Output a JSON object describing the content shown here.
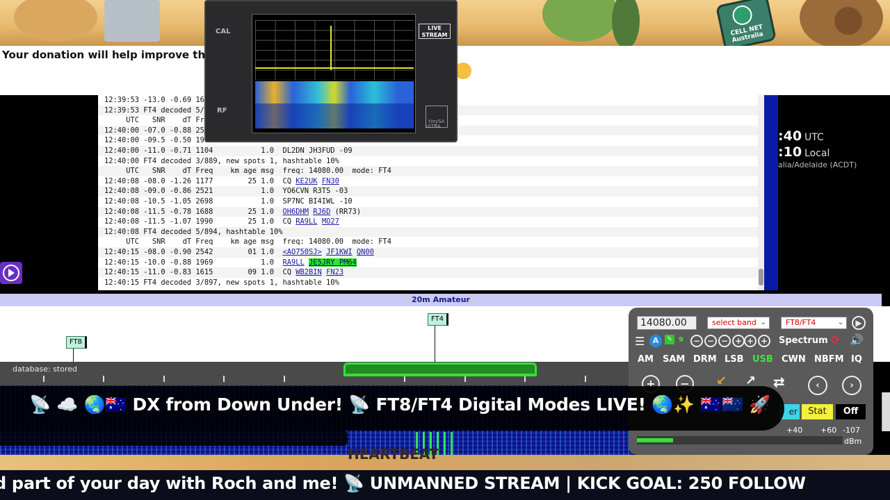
{
  "donation": {
    "text": "Your donation will help improve the"
  },
  "phone_ad": {
    "text": "CELL NET Australia"
  },
  "log": {
    "lines": [
      [
        {
          "t": "12:39:53 -13.0 -0.69 16"
        }
      ],
      [
        {
          "t": "12:39:53 FT4 decoded 5/"
        }
      ],
      [
        {
          "t": "     UTC   SNR    dT Fre"
        }
      ],
      [
        {
          "t": "12:40:00 -07.0 -0.88 254"
        }
      ],
      [
        {
          "t": "12:40:00 -09.5 -0.50 190"
        }
      ],
      [
        {
          "t": "12:40:00 -11.0 -0.71 1104           1.0  DL2DN JH3FUD -09"
        }
      ],
      [
        {
          "t": "12:40:00 FT4 decoded 3/889, new spots 1, hashtable 10%"
        }
      ],
      [
        {
          "t": "     UTC   SNR    dT Freq    km age msg  freq: 14080.00  mode: FT4"
        }
      ],
      [
        {
          "t": "12:40:08 -08.0 -1.26 1177        25 1.0  CQ "
        },
        {
          "t": "KE2UK",
          "c": "call"
        },
        {
          "t": " "
        },
        {
          "t": "FN30",
          "c": "call"
        }
      ],
      [
        {
          "t": "12:40:08 -09.0 -0.86 2521           1.0  YO6CVN R3TS -03"
        }
      ],
      [
        {
          "t": "12:40:08 -10.5 -1.05 2698           1.0  SP7NC BI4IWL -10"
        }
      ],
      [
        {
          "t": "12:40:08 -11.5 -0.78 1688        25 1.0  "
        },
        {
          "t": "OH6DHM",
          "c": "call"
        },
        {
          "t": " "
        },
        {
          "t": "RJ6D",
          "c": "call"
        },
        {
          "t": " (RR73)"
        }
      ],
      [
        {
          "t": "12:40:08 -11.5 -1.07 1990        25 1.0  CQ "
        },
        {
          "t": "RA9LL",
          "c": "call"
        },
        {
          "t": " "
        },
        {
          "t": "MO27",
          "c": "call"
        }
      ],
      [
        {
          "t": "12:40:08 FT4 decoded 5/894, hashtable 10%"
        }
      ],
      [
        {
          "t": "     UTC   SNR    dT Freq    km age msg  freq: 14080.00  mode: FT4"
        }
      ],
      [
        {
          "t": "12:40:15 -08.0 -0.90 2542        01 1.0  "
        },
        {
          "t": "<AO750SJ>",
          "c": "call"
        },
        {
          "t": " "
        },
        {
          "t": "JF1KWI",
          "c": "call"
        },
        {
          "t": " "
        },
        {
          "t": "QN00",
          "c": "call"
        }
      ],
      [
        {
          "t": "12:40:15 -10.0 -0.88 1969           1.0  "
        },
        {
          "t": "RA9LL",
          "c": "call"
        },
        {
          "t": " "
        },
        {
          "t": "JE5JRY PM64",
          "c": "call hl"
        }
      ],
      [
        {
          "t": "12:40:15 -11.0 -0.83 1615        09 1.0  CQ "
        },
        {
          "t": "WB2BIN",
          "c": "call"
        },
        {
          "t": " "
        },
        {
          "t": "FN23",
          "c": "call"
        }
      ],
      [
        {
          "t": "12:40:15 FT4 decoded 3/897, new spots 1, hashtable 10%"
        }
      ]
    ]
  },
  "clock": {
    "utc_time": ":40",
    "utc_label": "UTC",
    "local_time": ":10",
    "local_label": "Local",
    "timezone": "alia/Adelaide (ACDT)"
  },
  "tinysa": {
    "cal": "CAL",
    "rf": "RF",
    "live": "LIVE STREAM",
    "brand": "tinySA",
    "ultra": "ULTRA"
  },
  "band": {
    "name": "20m Amateur",
    "marker_ft8": "FT8",
    "marker_ft4": "FT4",
    "database": "database: stored"
  },
  "controls": {
    "frequency": "14080.00",
    "band_select": "select band",
    "mode_select": "FT8/FT4",
    "spectrum": "Spectrum",
    "modes": [
      "AM",
      "SAM",
      "DRM",
      "LSB",
      "USB",
      "CWN",
      "NBFM",
      "IQ"
    ],
    "active_mode": "USB",
    "badge_a": "A",
    "badge_9": "9",
    "stat": "Stat",
    "off": "Off",
    "cyan_partial": "er",
    "smeter_plus40": "+40",
    "smeter_plus60": "+60",
    "smeter_db": "-107",
    "smeter_unit": "dBm"
  },
  "banner": {
    "dx": "📡 ☁️ 🌏🇦🇺 DX from Down Under! 📡 FT8/FT4 Digital Modes LIVE! 🌏✨ 🇦🇺🇳🇿 🚀",
    "heartbeat": "HEARTBEAT",
    "ticker": "d part of your day with Roch and me!     📡 UNMANNED STREAM | KICK GOAL: 250 FOLLOW"
  },
  "colors": {
    "accent_green": "#35e035",
    "band_bar": "#c9c9f3",
    "link": "#1a1aa8",
    "highlight": "#2be82b"
  }
}
